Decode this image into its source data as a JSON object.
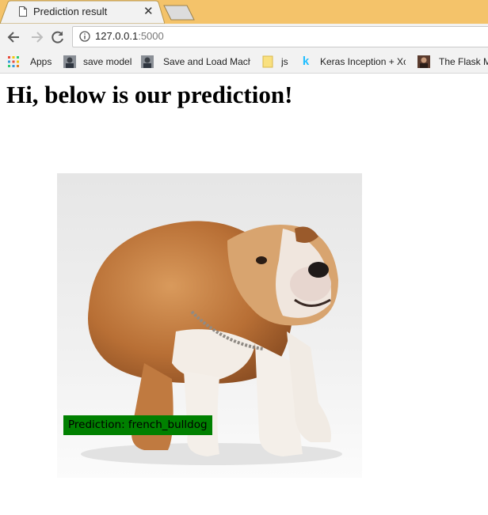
{
  "tab": {
    "title": "Prediction result",
    "close_icon": "close-icon"
  },
  "address_bar": {
    "host": "127.0.0.1",
    "port": ":5000"
  },
  "bookmarks": [
    {
      "label": "Apps",
      "icon": "apps-grid-icon"
    },
    {
      "label": "save model",
      "icon": "avatar-icon"
    },
    {
      "label": "Save and Load Mach",
      "icon": "avatar-icon"
    },
    {
      "label": "js",
      "icon": "folder-icon"
    },
    {
      "label": "Keras Inception + Xc",
      "icon": "kaggle-k-icon"
    },
    {
      "label": "The Flask M",
      "icon": "avatar-icon"
    }
  ],
  "page": {
    "heading": "Hi, below is our prediction!",
    "prediction_label": "Prediction: french_bulldog"
  },
  "colors": {
    "tabstrip": "#f4c36a",
    "label_background": "#008000"
  }
}
